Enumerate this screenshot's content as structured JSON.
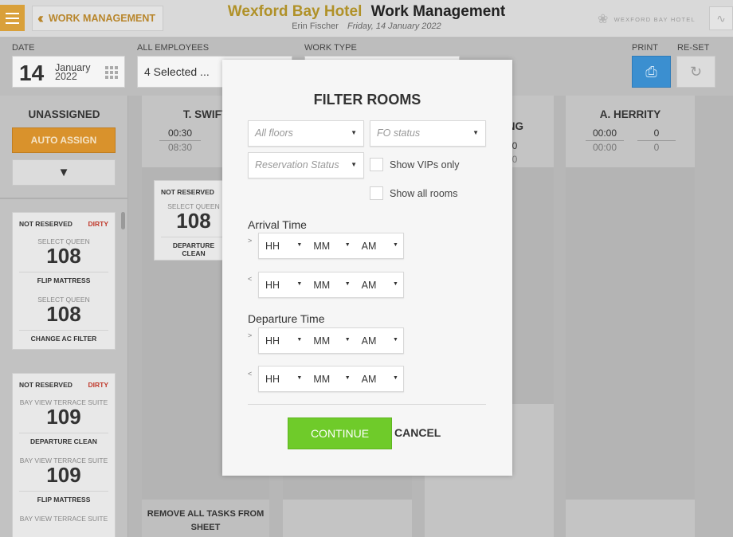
{
  "header": {
    "back_label": "WORK MANAGEMENT",
    "hotel_name": "Wexford Bay Hotel",
    "module_title": "Work Management",
    "user_name": "Erin Fischer",
    "date_text": "Friday, 14 January 2022",
    "brand_text": "WEXFORD BAY HOTEL",
    "accent_color": "#d9a03a"
  },
  "filters": {
    "date_label": "DATE",
    "date_day": "14",
    "date_month": "January",
    "date_year": "2022",
    "employees_label": "ALL EMPLOYEES",
    "employees_value": "4 Selected ...",
    "work_type_label": "WORK TYPE",
    "print_label": "PRINT",
    "reset_label": "RE-SET"
  },
  "unassigned": {
    "title": "UNASSIGNED",
    "auto_assign": "AUTO ASSIGN",
    "groups": [
      {
        "status": "NOT RESERVED",
        "condition": "DIRTY",
        "tasks": [
          {
            "room_type": "SELECT QUEEN",
            "room": "108",
            "task": "FLIP MATTRESS"
          },
          {
            "room_type": "SELECT QUEEN",
            "room": "108",
            "task": "CHANGE AC FILTER"
          }
        ]
      },
      {
        "status": "NOT RESERVED",
        "condition": "DIRTY",
        "tasks": [
          {
            "room_type": "BAY VIEW TERRACE SUITE",
            "room": "109",
            "task": "DEPARTURE CLEAN"
          },
          {
            "room_type": "BAY VIEW TERRACE SUITE",
            "room": "109",
            "task": "FLIP MATTRESS"
          },
          {
            "room_type": "BAY VIEW TERRACE SUITE",
            "room": "",
            "task": ""
          }
        ]
      }
    ]
  },
  "staff": [
    {
      "name": "T. SWIFT",
      "time1": "00:30",
      "time2": "08:30"
    },
    {
      "name": "O\nING",
      "count1": "0",
      "count2": "0"
    },
    {
      "name": "A. HERRITY",
      "time1": "00:00",
      "time2": "00:00",
      "count1": "0",
      "count2": "0"
    }
  ],
  "swift_card": {
    "status": "NOT RESERVED",
    "room_type": "SELECT QUEEN",
    "room": "108",
    "task": "DEPARTURE CLEAN"
  },
  "remove_all": "REMOVE ALL TASKS FROM SHEET",
  "modal": {
    "title": "FILTER ROOMS",
    "floors_placeholder": "All floors",
    "fo_status_placeholder": "FO status",
    "reservation_placeholder": "Reservation Status",
    "show_vips": "Show VIPs only",
    "show_all": "Show all rooms",
    "arrival_label": "Arrival Time",
    "departure_label": "Departure Time",
    "gt": ">",
    "lt": "<",
    "hh": "HH",
    "mm": "MM",
    "ampm": "AM",
    "continue": "CONTINUE",
    "cancel": "CANCEL",
    "continue_color": "#6fcb2a"
  }
}
